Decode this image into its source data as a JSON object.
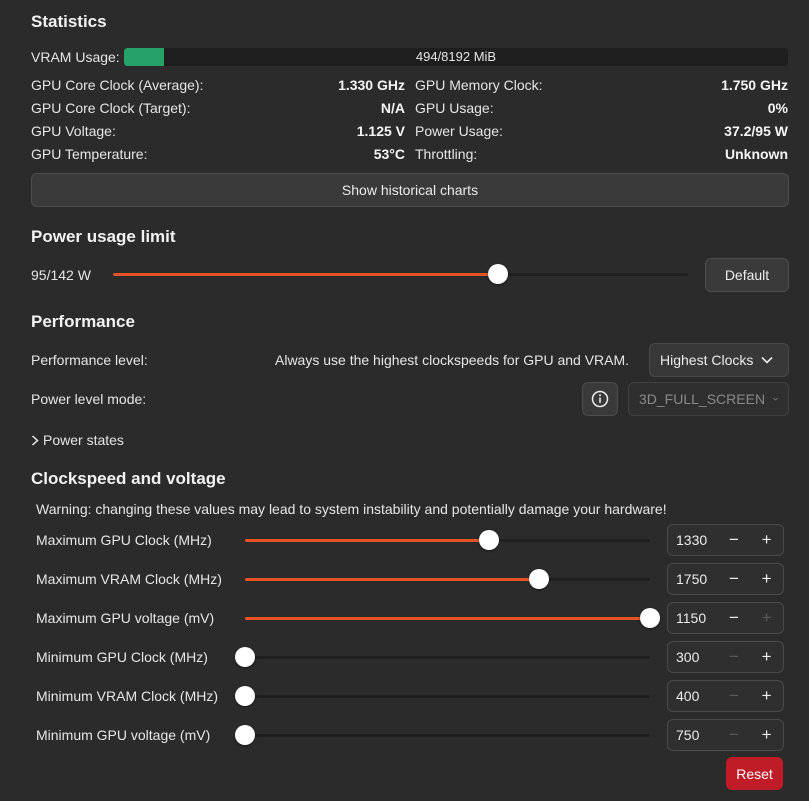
{
  "statistics": {
    "heading": "Statistics",
    "vram_label": "VRAM Usage:",
    "vram_text": "494/8192 MiB",
    "vram_fraction": 0.0603,
    "left": [
      {
        "label": "GPU Core Clock (Average):",
        "value": "1.330 GHz"
      },
      {
        "label": "GPU Core Clock (Target):",
        "value": "N/A"
      },
      {
        "label": "GPU Voltage:",
        "value": "1.125 V"
      },
      {
        "label": "GPU Temperature:",
        "value": "53°C"
      }
    ],
    "right": [
      {
        "label": "GPU Memory Clock:",
        "value": "1.750 GHz"
      },
      {
        "label": "GPU Usage:",
        "value": "0%"
      },
      {
        "label": "Power Usage:",
        "value": "37.2/95 W"
      },
      {
        "label": "Throttling:",
        "value": "Unknown"
      }
    ],
    "charts_button": "Show historical charts"
  },
  "power_limit": {
    "heading": "Power usage limit",
    "value_text": "95/142 W",
    "fraction": 0.669,
    "default_button": "Default"
  },
  "performance": {
    "heading": "Performance",
    "level_label": "Performance level:",
    "level_desc": "Always use the highest clockspeeds for GPU and VRAM.",
    "level_value": "Highest Clocks",
    "mode_label": "Power level mode:",
    "mode_value": "3D_FULL_SCREEN",
    "power_states": "Power states"
  },
  "clocks": {
    "heading": "Clockspeed and voltage",
    "warning": "Warning: changing these values may lead to system instability and potentially damage your hardware!",
    "rows": [
      {
        "label": "Maximum GPU Clock (MHz)",
        "value": "1330",
        "fraction": 0.603,
        "minus_enabled": true,
        "plus_enabled": true
      },
      {
        "label": "Maximum VRAM Clock (MHz)",
        "value": "1750",
        "fraction": 0.725,
        "minus_enabled": true,
        "plus_enabled": true
      },
      {
        "label": "Maximum GPU voltage (mV)",
        "value": "1150",
        "fraction": 1.0,
        "minus_enabled": true,
        "plus_enabled": false
      },
      {
        "label": "Minimum GPU Clock (MHz)",
        "value": "300",
        "fraction": 0.0,
        "minus_enabled": false,
        "plus_enabled": true
      },
      {
        "label": "Minimum VRAM Clock (MHz)",
        "value": "400",
        "fraction": 0.0,
        "minus_enabled": false,
        "plus_enabled": true
      },
      {
        "label": "Minimum GPU voltage (mV)",
        "value": "750",
        "fraction": 0.0,
        "minus_enabled": false,
        "plus_enabled": true
      }
    ],
    "minus_symbol": "−",
    "plus_symbol": "+",
    "reset_button": "Reset"
  },
  "colors": {
    "accent": "#e55426",
    "vram_bar": "#26a269",
    "reset": "#c01c28"
  }
}
